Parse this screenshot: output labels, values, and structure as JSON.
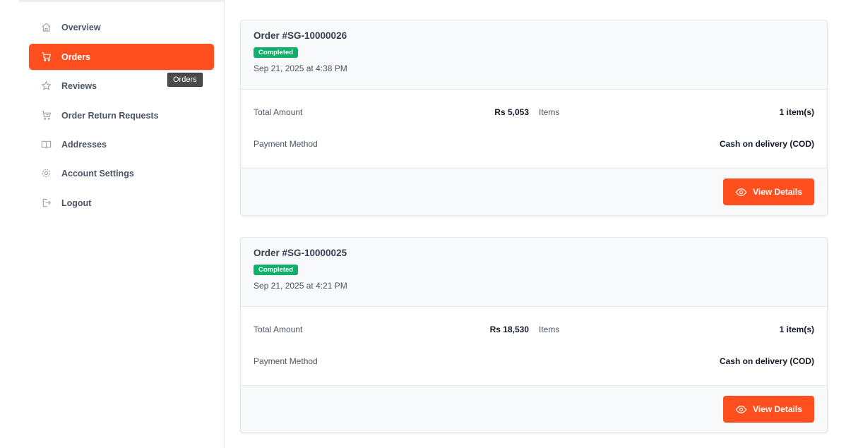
{
  "sidebar": {
    "items": [
      {
        "label": "Overview",
        "icon": "home-icon"
      },
      {
        "label": "Orders",
        "icon": "cart-icon"
      },
      {
        "label": "Reviews",
        "icon": "star-icon"
      },
      {
        "label": "Order Return Requests",
        "icon": "return-cart-icon"
      },
      {
        "label": "Addresses",
        "icon": "book-icon"
      },
      {
        "label": "Account Settings",
        "icon": "gear-icon"
      },
      {
        "label": "Logout",
        "icon": "logout-icon"
      }
    ],
    "active_item": "Orders",
    "tooltip": "Orders"
  },
  "orders": [
    {
      "title": "Order #SG-10000026",
      "status": "Completed",
      "date": "Sep 21, 2025 at 4:38 PM",
      "total_label": "Total Amount",
      "total_value": "Rs 5,053",
      "items_label": "Items",
      "items_value": "1 item(s)",
      "payment_label": "Payment Method",
      "payment_value": "Cash on delivery (COD)",
      "button_label": "View Details"
    },
    {
      "title": "Order #SG-10000025",
      "status": "Completed",
      "date": "Sep 21, 2025 at 4:21 PM",
      "total_label": "Total Amount",
      "total_value": "Rs 18,530",
      "items_label": "Items",
      "items_value": "1 item(s)",
      "payment_label": "Payment Method",
      "payment_value": "Cash on delivery (COD)",
      "button_label": "View Details"
    }
  ],
  "colors": {
    "accent": "#ff4f1f",
    "success": "#10b06b"
  }
}
